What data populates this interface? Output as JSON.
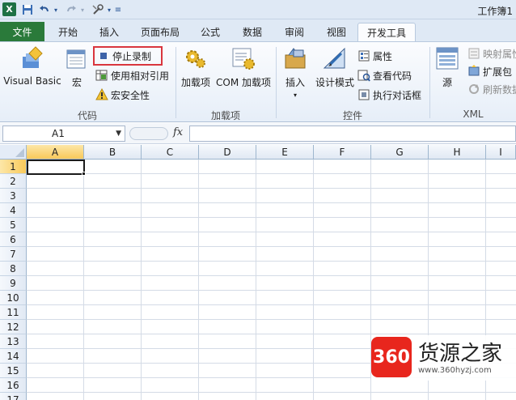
{
  "titlebar": {
    "excel_logo": "X",
    "title": "工作簿1",
    "icons": [
      "excel-logo",
      "save-icon",
      "undo-icon",
      "redo-icon",
      "tools-icon",
      "customize-qat-icon"
    ]
  },
  "tabs": {
    "file": "文件",
    "items": [
      "开始",
      "插入",
      "页面布局",
      "公式",
      "数据",
      "审阅",
      "视图",
      "开发工具"
    ],
    "active": "开发工具"
  },
  "ribbon": {
    "code": {
      "label": "代码",
      "visual_basic": "Visual Basic",
      "macros": "宏",
      "stop_recording": "停止录制",
      "relative_refs": "使用相对引用",
      "macro_security": "宏安全性"
    },
    "addins": {
      "label": "加载项",
      "addins": "加载项",
      "com_addins": "COM 加载项"
    },
    "controls": {
      "label": "控件",
      "insert": "插入",
      "design_mode": "设计模式",
      "properties": "属性",
      "view_code": "查看代码",
      "run_dialog": "执行对话框"
    },
    "xml": {
      "label": "XML",
      "source": "源",
      "map_properties": "映射属性",
      "expansion_packs": "扩展包",
      "refresh_data": "刷新数据"
    }
  },
  "formula_bar": {
    "name_box": "A1",
    "fx": "fx",
    "value": ""
  },
  "grid": {
    "columns": [
      "A",
      "B",
      "C",
      "D",
      "E",
      "F",
      "G",
      "H",
      "I"
    ],
    "rows": [
      "1",
      "2",
      "3",
      "4",
      "5",
      "6",
      "7",
      "8",
      "9",
      "10",
      "11",
      "12",
      "13",
      "14",
      "15",
      "16",
      "17"
    ],
    "active_cell": "A1"
  },
  "watermark": {
    "badge": "360",
    "title": "货源之家",
    "url": "www.360hyzj.com"
  },
  "colors": {
    "file_tab": "#2a7a3a",
    "highlight_border": "#d9363e",
    "selected_header": "#f8c95a"
  }
}
